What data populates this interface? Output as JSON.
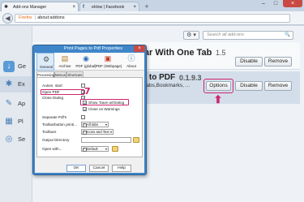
{
  "browser": {
    "tabs": [
      {
        "label": "Add-ons Manager",
        "close": "×"
      },
      {
        "label": "eHow | Facebook",
        "close": "×"
      }
    ],
    "new_tab": "+",
    "window": {
      "minimize": "–",
      "maximize": "□",
      "close": "×"
    },
    "url": {
      "brand": "Firefox",
      "separator": "|",
      "text": "about:addons"
    },
    "back": "◀"
  },
  "sidebar": {
    "items": [
      {
        "label": "Ge",
        "icon": "get-addons-icon"
      },
      {
        "label": "Ex",
        "icon": "extensions-icon"
      },
      {
        "label": "Ap",
        "icon": "appearance-icon"
      },
      {
        "label": "Pl",
        "icon": "plugins-icon"
      },
      {
        "label": "Se",
        "icon": "services-icon"
      }
    ]
  },
  "toolbar": {
    "gear": "⚙ ▾",
    "search_placeholder": "Search all add-ons",
    "search_icon": "🔍"
  },
  "addons": [
    {
      "title": "Bar With One Tab",
      "version": "1.5",
      "disable": "Disable",
      "remove": "Remove"
    },
    {
      "title": "es to PDF",
      "version": "0.1.9.3",
      "description": "m Tabs,Bookmarks, ...",
      "options": "Options",
      "disable": "Disable",
      "remove": "Remove"
    }
  ],
  "dialog": {
    "title": "Print Pages to Pdf Properties",
    "close": "×",
    "toolbar": [
      {
        "label": "General",
        "icon": "general-icon"
      },
      {
        "label": "Archive",
        "icon": "archive-icon"
      },
      {
        "label": "PDF (global)",
        "icon": "pdf-global-icon"
      },
      {
        "label": "PDF (Webpage)",
        "icon": "pdf-webpage-icon"
      },
      {
        "label": "About",
        "icon": "about-icon"
      }
    ],
    "subtabs": [
      "Processing",
      "Menus",
      "Shortcuts"
    ],
    "options": {
      "autom_start": "Autom. start",
      "open_pdf": "Open PDF",
      "close_dialog": "Close Dialog",
      "show_save_as": "Show 'Save as'Dialog",
      "close_on_warnings": "Close on Warnings",
      "separate_pdfs": "Separate Pdf's",
      "toolbarbutton_label": "Toolbarbutton printi...",
      "toolbarbutton_value": "All tabs",
      "toolbars_label": "Toolbars",
      "toolbars_value": "Icons and Text",
      "output_label": "Output Directory",
      "open_with_label": "Open with...",
      "open_with_value": "Default"
    },
    "check": "✓",
    "buttons": {
      "ok": "OK",
      "cancel": "Cancel",
      "help": "Help"
    }
  },
  "annotations": {
    "step_number": "7",
    "arrow": "⬆"
  }
}
